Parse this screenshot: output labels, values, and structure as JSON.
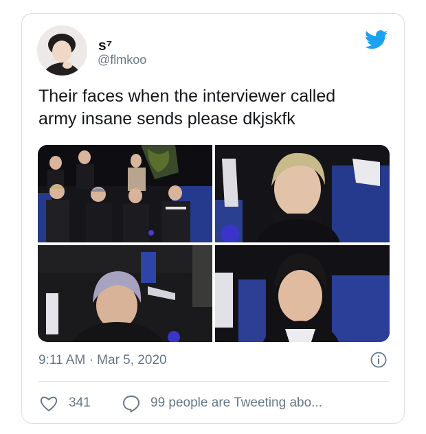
{
  "author": {
    "name": "s⁷",
    "handle": "@flmkoo"
  },
  "tweet": {
    "text_line1": "Their faces when the interviewer called",
    "text_line2": "army insane sends please dkjskfk"
  },
  "meta": {
    "timestamp": "9:11 AM · Mar 5, 2020"
  },
  "actions": {
    "like_count": "341",
    "conversation_text": "99 people are Tweeting abo..."
  },
  "colors": {
    "twitter_blue": "#1da1f2",
    "secondary_text": "#657786",
    "primary_text": "#14171a"
  },
  "icons": {
    "brand": "twitter-bird-icon",
    "info": "info-icon",
    "like": "heart-icon",
    "reply": "speech-bubble-icon"
  }
}
